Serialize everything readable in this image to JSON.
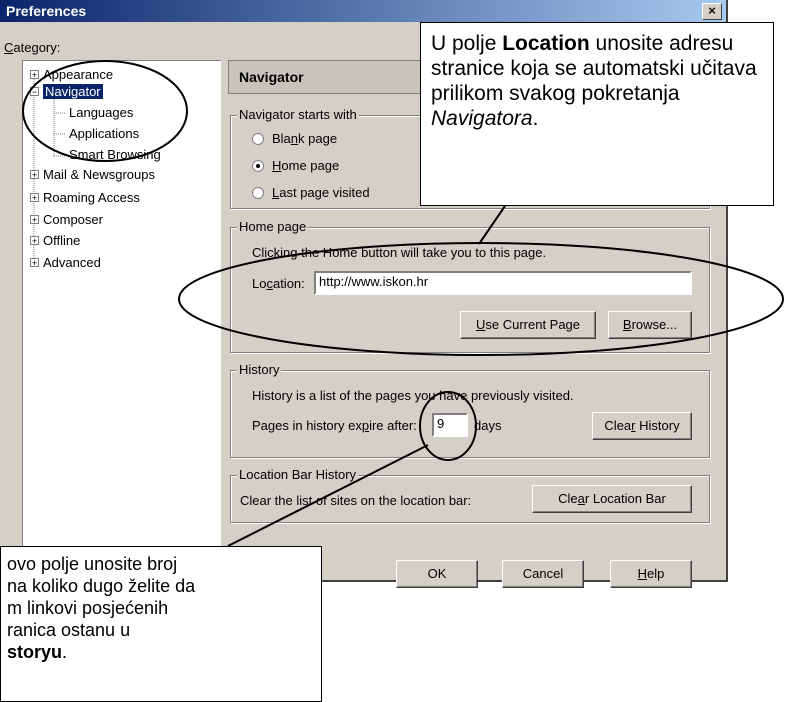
{
  "window": {
    "title": "Preferences",
    "close_label": "×"
  },
  "category": {
    "label": "Category:",
    "mnemonic": "C",
    "rest": "ategory:"
  },
  "tree": {
    "items": [
      {
        "label": "Appearance",
        "expander": "+"
      },
      {
        "label": "Navigator",
        "expander": "−"
      },
      {
        "label": "Languages"
      },
      {
        "label": "Applications"
      },
      {
        "label": "Smart Browsing"
      },
      {
        "label": "Mail & Newsgroups",
        "expander": "+"
      },
      {
        "label": "Roaming Access",
        "expander": "+"
      },
      {
        "label": "Composer",
        "expander": "+"
      },
      {
        "label": "Offline",
        "expander": "+"
      },
      {
        "label": "Advanced",
        "expander": "+"
      }
    ]
  },
  "panel": {
    "header": "Navigator"
  },
  "starts_with": {
    "label": "Navigator starts with",
    "options": [
      {
        "pre": "Bla",
        "mn": "n",
        "post": "k page",
        "selected": false
      },
      {
        "pre": "",
        "mn": "H",
        "post": "ome page",
        "selected": true
      },
      {
        "pre": "",
        "mn": "L",
        "post": "ast page visited",
        "selected": false
      }
    ]
  },
  "home_page": {
    "label": "Home page",
    "description": "Clicking the Home button will take you to this page.",
    "location_pre": "Lo",
    "location_mn": "c",
    "location_post": "ation:",
    "location_value": "http://www.iskon.hr",
    "use_current_mn": "U",
    "use_current_rest": "se Current Page",
    "browse_mn": "B",
    "browse_rest": "rowse..."
  },
  "history": {
    "label": "History",
    "description": "History is a list of the pages you have previously visited.",
    "expire_pre": "Pages in history ex",
    "expire_mn": "p",
    "expire_post": "ire after:",
    "days_value": "9",
    "days_label": "days",
    "clear_pre": "Clea",
    "clear_mn": "r",
    "clear_post": " History"
  },
  "location_bar_history": {
    "label": "Location Bar History",
    "description": "Clear the list of sites on the location bar:",
    "clear_pre": "Cle",
    "clear_mn": "a",
    "clear_post": "r Location Bar"
  },
  "buttons": {
    "ok": "OK",
    "cancel": "Cancel",
    "help_mn": "H",
    "help_rest": "elp"
  },
  "callout_top": {
    "t1": "U polje ",
    "t2": "Location",
    "t3": " unosite adresu stranice koja se automatski učitava prilikom svakog pokretanja ",
    "t4": "Navigatora",
    "t5": "."
  },
  "callout_bottom": {
    "line1": "ovo polje unosite broj",
    "line2": "na koliko dugo želite da",
    "line3": "m linkovi posjećenih",
    "line4": "ranica ostanu u",
    "line5_bold": "storyu",
    "line5_end": "."
  }
}
